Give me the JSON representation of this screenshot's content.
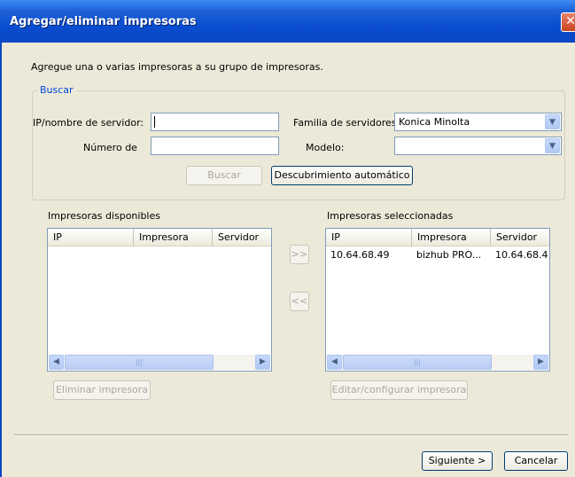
{
  "window": {
    "title": "Agregar/eliminar impresoras",
    "close_label": "✕"
  },
  "intro": "Agregue una o varias impresoras a su grupo de impresoras.",
  "search": {
    "legend": "Buscar",
    "server_label": "IP/nombre de servidor:",
    "server_value": "",
    "number_label": "Número de",
    "number_value": "",
    "family_label": "Familia de servidores:",
    "family_value": "Konica Minolta",
    "model_label": "Modelo:",
    "model_value": "",
    "search_button": "Buscar",
    "auto_button": "Descubrimiento automático"
  },
  "available": {
    "label": "Impresoras disponibles",
    "columns": [
      "IP",
      "Impresora",
      "Servidor"
    ],
    "rows": []
  },
  "selected": {
    "label": "Impresoras seleccionadas",
    "columns": [
      "IP",
      "Impresora",
      "Servidor"
    ],
    "rows": [
      {
        "ip": "10.64.68.49",
        "printer": "bizhub PRO...",
        "server": "10.64.68.4!"
      }
    ]
  },
  "transfer": {
    "add": ">>",
    "remove": "<<"
  },
  "buttons": {
    "remove_printer": "Eliminar impresora",
    "edit_printer": "Editar/configurar impresora",
    "next": "Siguiente >",
    "cancel": "Cancelar"
  },
  "icons": {
    "scroll_left": "◀",
    "scroll_right": "▶",
    "dropdown": "▼",
    "thumb_grip": "|||"
  }
}
